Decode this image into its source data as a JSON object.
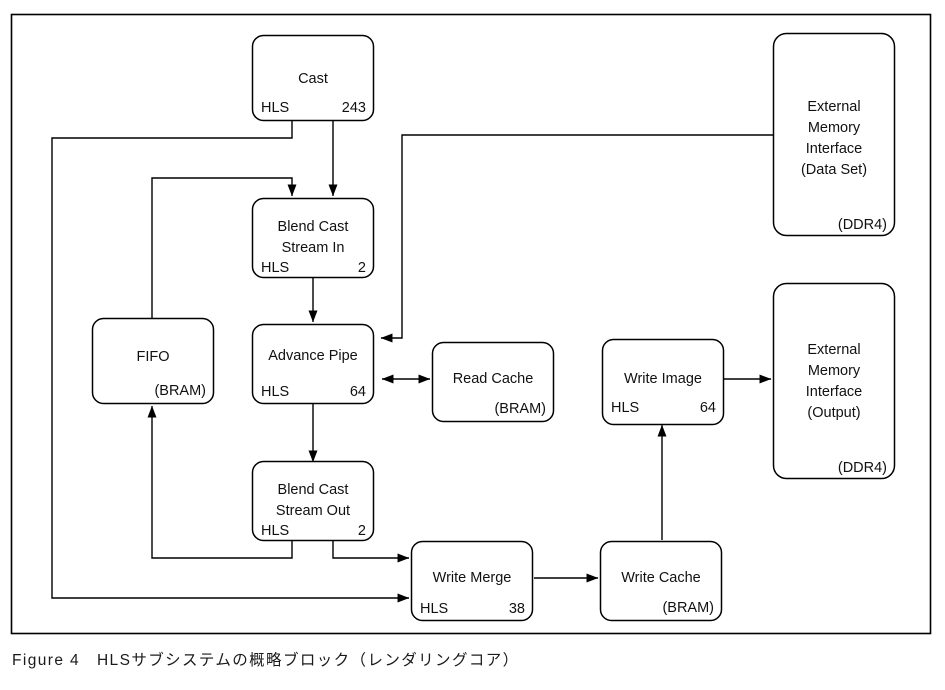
{
  "figure": {
    "caption": "Figure 4　HLSサブシステムの概略ブロック（レンダリングコア）",
    "frame_color": "#000000",
    "line_color": "#000000",
    "background_color": "#ffffff"
  },
  "nodes": {
    "cast": {
      "title": "Cast",
      "corner_left": "HLS",
      "corner_right": "243"
    },
    "blend_cast_stream_in": {
      "title_line1": "Blend Cast",
      "title_line2": "Stream In",
      "corner_left": "HLS",
      "corner_right": "2"
    },
    "advance_pipe": {
      "title": "Advance Pipe",
      "corner_left": "HLS",
      "corner_right": "64"
    },
    "blend_cast_stream_out": {
      "title_line1": "Blend Cast",
      "title_line2": "Stream Out",
      "corner_left": "HLS",
      "corner_right": "2"
    },
    "fifo": {
      "title": "FIFO",
      "corner_right": "(BRAM)"
    },
    "read_cache": {
      "title": "Read Cache",
      "corner_right": "(BRAM)"
    },
    "write_merge": {
      "title": "Write Merge",
      "corner_left": "HLS",
      "corner_right": "38"
    },
    "write_cache": {
      "title": "Write Cache",
      "corner_right": "(BRAM)"
    },
    "write_image": {
      "title": "Write Image",
      "corner_left": "HLS",
      "corner_right": "64"
    },
    "external_memory_dataset": {
      "title_line1": "External",
      "title_line2": "Memory",
      "title_line3": "Interface",
      "title_line4": "(Data Set)",
      "corner_right": "(DDR4)"
    },
    "external_memory_output": {
      "title_line1": "External",
      "title_line2": "Memory",
      "title_line3": "Interface",
      "title_line4": "(Output)",
      "corner_right": "(DDR4)"
    }
  }
}
